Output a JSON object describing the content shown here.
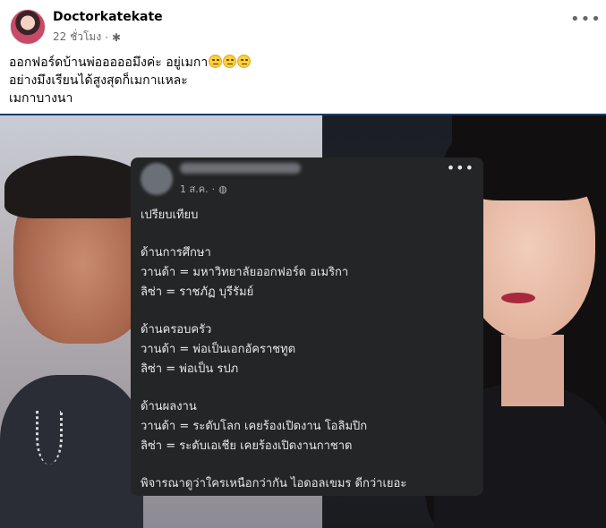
{
  "post": {
    "author": "Doctorkatekate",
    "time": "22 ชั่วโมง",
    "meta_sep": "·",
    "privacy_icon": "gear-icon",
    "more_icon": "more-horizontal-icon",
    "caption_lines": [
      "ออกฟอร์ดบ้านพ่อออออมึงค่ะ อยู่เมกา",
      "อย่างมึงเรียนได้สูงสุดก็เมกาแหละ",
      "เมกาบางนา"
    ],
    "caption_emoji": "rolling-eyes-emoji"
  },
  "card": {
    "time": "1 ส.ค.",
    "meta_sep": "·",
    "privacy_icon": "globe-icon",
    "title": "เปรียบเทียบ",
    "sections": [
      {
        "heading": "ด้านการศึกษา",
        "lines": [
          "วานด้า = มหาวิทยาลัยออกฟอร์ด อเมริกา",
          "ลิซ่า = ราชภัฏ บุรีรัมย์"
        ]
      },
      {
        "heading": "ด้านครอบครัว",
        "lines": [
          "วานด้า = พ่อเป็นเอกอัคราชทูต",
          "ลิซ่า = พ่อเป็น รปภ"
        ]
      },
      {
        "heading": "ด้านผลงาน",
        "lines": [
          "วานด้า = ระดับโลก เคยร้องเปิดงาน โอลิมปิก",
          "ลิซ่า = ระดับเอเชีย เคยร้องเปิดงานกาชาด"
        ]
      }
    ],
    "conclusion": "พิจารณาดูว่าใครเหนือกว่ากัน ไอดอลเขมร ดีกว่าเยอะ"
  },
  "colors": {
    "text_primary": "#050505",
    "text_secondary": "#65676b",
    "card_bg": "#242526",
    "card_text": "#e4e6eb"
  }
}
